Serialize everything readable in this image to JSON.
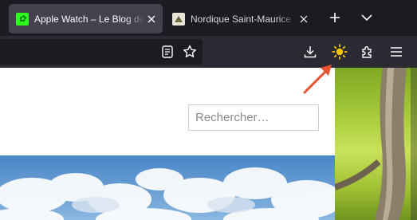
{
  "tabs": [
    {
      "title": "Apple Watch – Le Blog de l'Apple Watch",
      "favicon": "leaf-green-icon",
      "active": true
    },
    {
      "title": "Nordique Saint-Maurice – Le Nordique",
      "favicon": "lodge-icon",
      "active": false
    }
  ],
  "toolbar": {
    "buttons": [
      "reader-view-icon",
      "bookmark-star-icon",
      "download-icon",
      "sun-icon",
      "extensions-puzzle-icon",
      "hamburger-menu-icon"
    ]
  },
  "page": {
    "search_placeholder": "Rechercher…"
  },
  "colors": {
    "tab_active_bg": "#42414d",
    "toolbar_bg": "#2b2a33",
    "annotation_arrow": "#e8532e",
    "sun": "#f7c400"
  }
}
